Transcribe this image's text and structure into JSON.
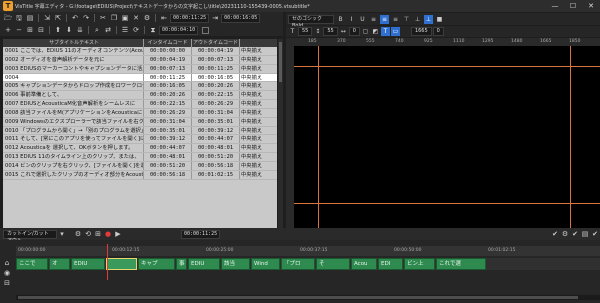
{
  "window": {
    "title": "VisTitle 字幕エディタ - G:\\footage\\EDIUS\\Project\\テキストデータからの文字起こし\\title\\20231110-155439-0005.vtsubtitle*",
    "minimize": "—",
    "maximize": "☐",
    "close": "✕"
  },
  "toolbar": {
    "timecode_in": "00:00:11:25",
    "timecode_out": "00:00:16:05",
    "timecode_dur": "00:00:04:10"
  },
  "table": {
    "headers": {
      "subtitle": "サブタイトルテキスト",
      "in": "インタイムコード",
      "out": "アウトタイムコード",
      "style": ""
    },
    "rows": [
      {
        "no": "0001",
        "text": "ここでは、EDIUS 11のオーディオコンテンツ(Acousti",
        "in": "00:00:00:00",
        "out": "00:00:04:19",
        "style": "中央揃え"
      },
      {
        "no": "0002",
        "text": "オーディオを音声解析データを元に",
        "in": "00:00:04:19",
        "out": "00:00:07:13",
        "style": "中央揃え"
      },
      {
        "no": "0003",
        "text": "EDIUSのマーカーコントやキャプションデータに活用",
        "in": "00:00:07:13",
        "out": "00:00:11:25",
        "style": "中央揃え"
      },
      {
        "no": "0004",
        "text": "",
        "in": "00:00:11:25",
        "out": "00:00:16:05",
        "style": "中央揃え"
      },
      {
        "no": "0005",
        "text": "キャプションデータからドロップ作成をロワークロー",
        "in": "00:00:16:05",
        "out": "00:00:20:26",
        "style": "中央揃え"
      },
      {
        "no": "0006",
        "text": "事前準備として、",
        "in": "00:00:20:26",
        "out": "00:00:22:15",
        "style": "中央揃え"
      },
      {
        "no": "0007",
        "text": "EDIUSとAcousticaM化音声解析をシームレスに",
        "in": "00:00:22:15",
        "out": "00:00:26:29",
        "style": "中央揃え"
      },
      {
        "no": "0008",
        "text": "該当ファイルをM(アプリケーションをAcousticaに",
        "in": "00:00:26:29",
        "out": "00:00:31:04",
        "style": "中央揃え"
      },
      {
        "no": "0009",
        "text": "Windowsのエクスプローラーで該当ファイルを右クリック",
        "in": "00:00:31:04",
        "out": "00:00:35:01",
        "style": "中央揃え"
      },
      {
        "no": "0010",
        "text": "「プログラムから開く」→「別のプログラムを選択」",
        "in": "00:00:35:01",
        "out": "00:00:39:12",
        "style": "中央揃え"
      },
      {
        "no": "0011",
        "text": "そして、[常にこのアプリを使ってファイルを開く]に",
        "in": "00:00:39:12",
        "out": "00:00:44:07",
        "style": "中央揃え"
      },
      {
        "no": "0012",
        "text": "Acousticaを 選択して、OKボタンを押します。",
        "in": "00:00:44:07",
        "out": "00:00:48:01",
        "style": "中央揃え"
      },
      {
        "no": "0013",
        "text": "EDIUS 11のタイムライン上のクリップ、または、",
        "in": "00:00:48:01",
        "out": "00:00:51:20",
        "style": "中央揃え"
      },
      {
        "no": "0014",
        "text": "ビンのクリップを右クリック、[ファイルを開く]を選択",
        "in": "00:00:51:20",
        "out": "00:00:56:18",
        "style": "中央揃え"
      },
      {
        "no": "0015",
        "text": "これで選択したクリップのオーディオ部分をAcoustic",
        "in": "00:00:56:18",
        "out": "00:01:02:15",
        "style": "中央揃え"
      }
    ],
    "selected_index": 3
  },
  "style_panel": {
    "font": "セのゴシック Bold",
    "size": "55",
    "leading": "55",
    "tracking": "0",
    "x": "1665",
    "y": "0"
  },
  "preview_ruler": {
    "ticks": [
      "185",
      "370",
      "555",
      "740",
      "925",
      "1110",
      "1295",
      "1480",
      "1665",
      "1850"
    ]
  },
  "timeline": {
    "preset": "カットイン/カットアウト",
    "transport_timecode": "00:00:11:25",
    "ruler_ticks": [
      "00:00:00:00",
      "00:00:12:15",
      "00:00:25:00",
      "00:00:37:15",
      "00:00:50:00",
      "00:01:02:15"
    ],
    "clips": [
      "ここで",
      "オ",
      "EDIU",
      "",
      "キャプ",
      "事",
      "EDIU",
      "該当",
      "Wind",
      "「プロ",
      "そ",
      "Acou",
      "EDI",
      "ビン上",
      "これで選"
    ]
  }
}
